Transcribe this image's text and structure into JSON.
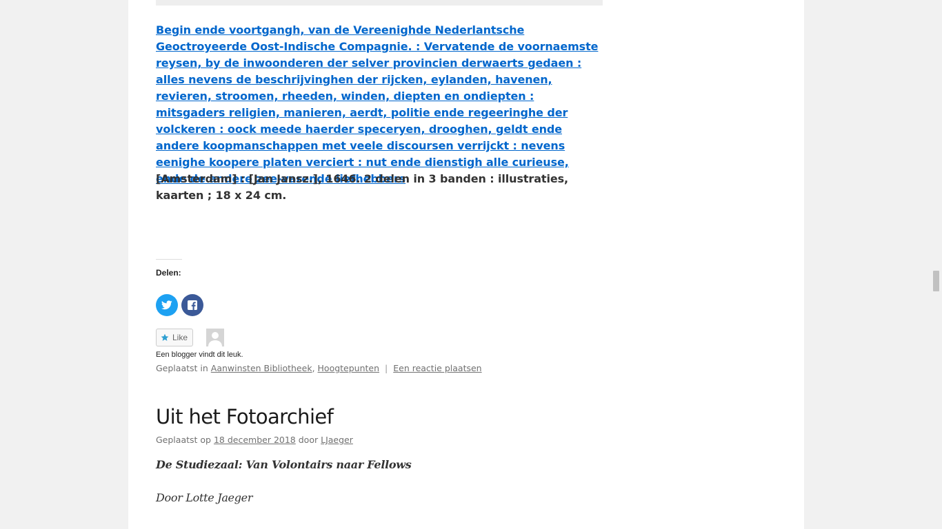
{
  "book": {
    "title_link": "Begin ende voortgangh, van de Vereenighde Nederlantsche Geoctroyeerde Oost-Indische Compagnie. : Vervatende de voornaemste reysen, by de inwoonderen der selver provincien derwaerts gedaen : alles nevens de beschrijvinghen der rijcken, eylanden, havenen, revieren, stroomen, rheeden, winden, diepten en ondiepten : mitsgaders religien, manieren, aerdt, politie ende regeeringhe der volckeren : oock meede haerder speceryen, drooghen, geldt ende andere koopmanschappen met veele discoursen verrijckt : nevens eenighe koopere platen verciert : nut ende dienstigh alle curieuse, ende de andere zee-varende liefhebbers",
    "publication": "[Amsterdam] : [Jan Jansz.], 1646. 2 delen in 3 banden : illustraties, kaarten ; 18 x 24 cm."
  },
  "share": {
    "heading": "Delen:",
    "twitter_icon": "twitter-icon",
    "facebook_icon": "facebook-icon"
  },
  "likes": {
    "button_label": "Like",
    "note": "Een blogger vindt dit leuk."
  },
  "post_footer": {
    "prefix": "Geplaatst in",
    "category1": "Aanwinsten Bibliotheek",
    "comma": ",",
    "category2": "Hoogtepunten",
    "separator": "|",
    "comment_link": "Een reactie plaatsen"
  },
  "next_post": {
    "title": "Uit het Fotoarchief",
    "meta_prefix": "Geplaatst op",
    "date": "18 december 2018",
    "meta_by": "door",
    "author": "LJaeger",
    "subtitle": "De Studiezaal: Van Volontairs naar Fellows",
    "byline": "Door Lotte Jaeger"
  },
  "colors": {
    "link": "#0066cc",
    "twitter": "#1da1f2",
    "facebook": "#3b5998",
    "page_background": "#f1f1f1"
  }
}
